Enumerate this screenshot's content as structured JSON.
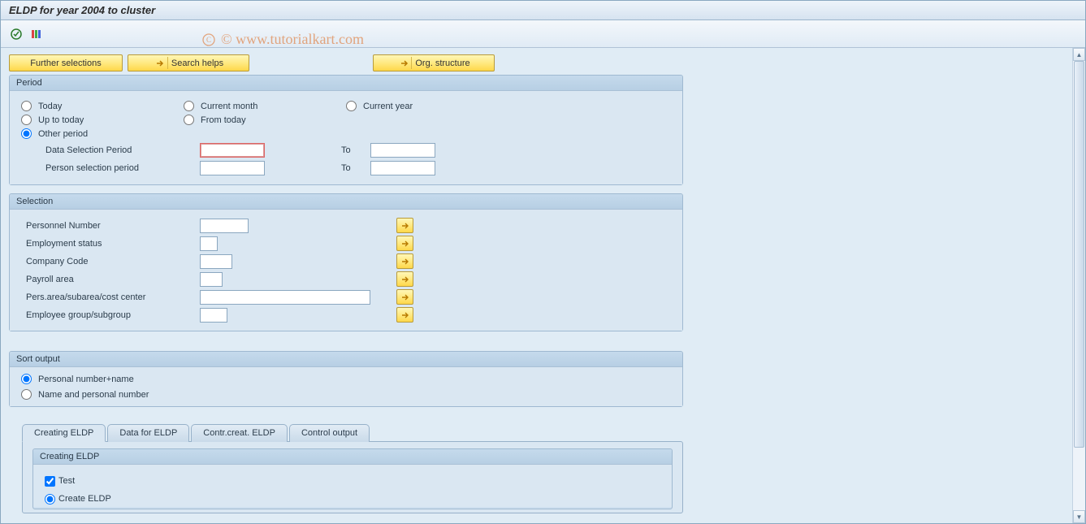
{
  "title": "ELDP for year 2004 to cluster",
  "watermark": "© www.tutorialkart.com",
  "buttons": {
    "further_selections": "Further selections",
    "search_helps": "Search helps",
    "org_structure": "Org. structure"
  },
  "period": {
    "title": "Period",
    "today": "Today",
    "current_month": "Current month",
    "current_year": "Current year",
    "up_to_today": "Up to today",
    "from_today": "From today",
    "other_period": "Other period",
    "data_selection_period": "Data Selection Period",
    "person_selection_period": "Person selection period",
    "to": "To"
  },
  "selection": {
    "title": "Selection",
    "personnel_number": "Personnel Number",
    "employment_status": "Employment status",
    "company_code": "Company Code",
    "payroll_area": "Payroll area",
    "pers_area": "Pers.area/subarea/cost center",
    "employee_group": "Employee group/subgroup"
  },
  "sort_output": {
    "title": "Sort output",
    "pn_name": "Personal number+name",
    "name_pn": "Name and personal number"
  },
  "tabs": {
    "creating": "Creating ELDP",
    "data_for": "Data for ELDP",
    "contr": "Contr.creat. ELDP",
    "control_output": "Control output"
  },
  "creating_eldp": {
    "title": "Creating ELDP",
    "test": "Test",
    "create": "Create ELDP"
  }
}
